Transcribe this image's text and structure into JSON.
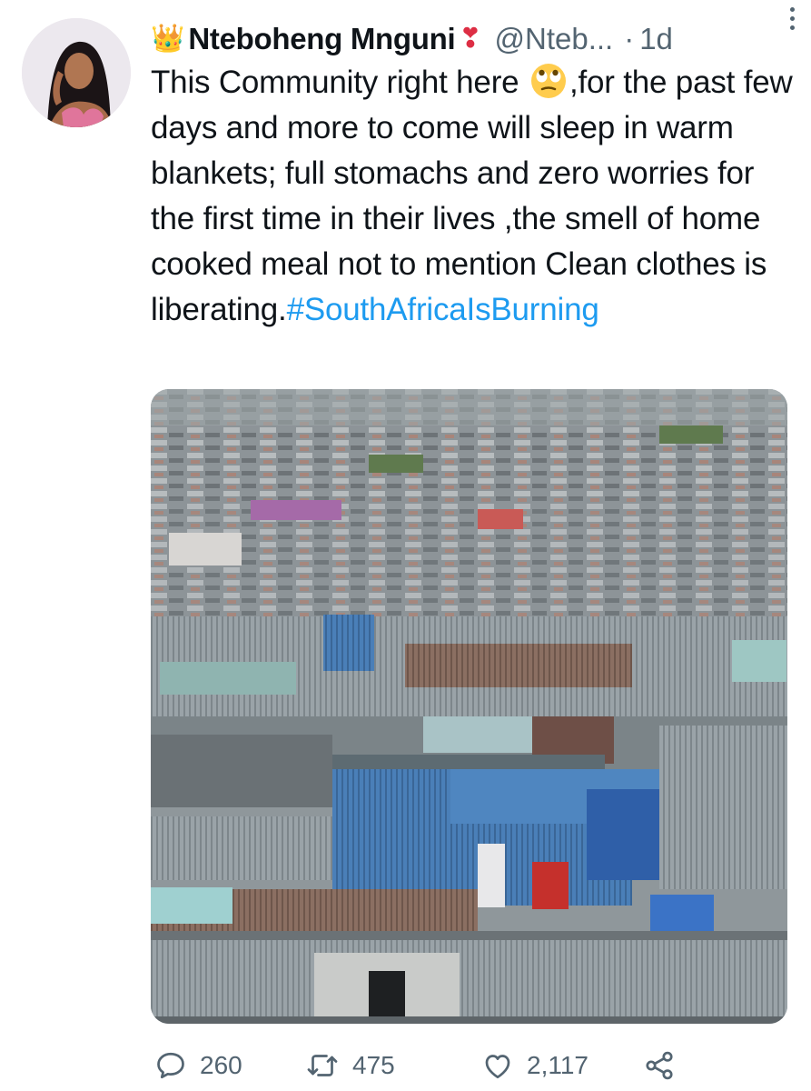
{
  "tweet": {
    "author": {
      "crown_emoji": "👑",
      "display_name": "Nteboheng Mnguni",
      "heart_emoji": "❣",
      "handle": "@Nteb...",
      "separator": "·",
      "time": "1d"
    },
    "text": {
      "part1": "This Community right here ",
      "emoji": "rolling-eyes-emoji",
      "part2": ",for the past few days and more to come will sleep in warm blankets; full stomachs and zero worries for the first time in their lives ,the smell of home cooked meal not to mention Clean clothes is liberating.",
      "hashtag": "#SouthAfricaIsBurning"
    },
    "media": {
      "icon": "township-photo"
    },
    "actions": {
      "reply_count": "260",
      "retweet_count": "475",
      "like_count": "2,117"
    }
  },
  "colors": {
    "text": "#0f1419",
    "secondary": "#536471",
    "link": "#1d9bf0",
    "heart": "#dd2e44"
  }
}
